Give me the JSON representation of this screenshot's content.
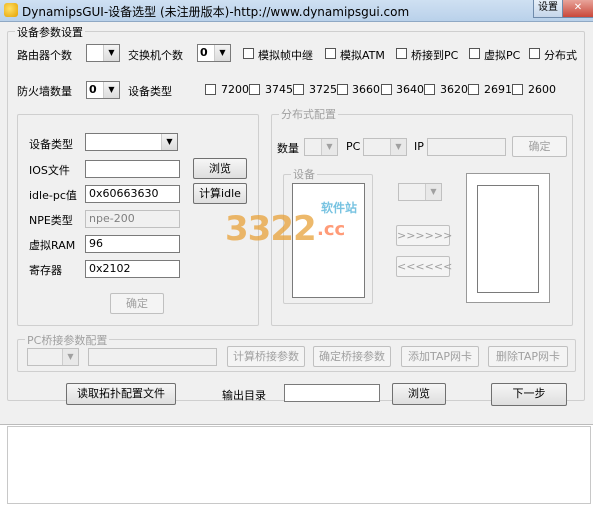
{
  "window": {
    "title": "DynamipsGUI-设备选型 (未注册版本)-http://www.dynamipsgui.com",
    "settings_label": "设置",
    "close_label": "✕"
  },
  "main_group": {
    "title": "设备参数设置",
    "router_count_label": "路由器个数",
    "router_count_value": "",
    "switch_count_label": "交换机个数",
    "switch_count_value": "0",
    "checkboxes_top": [
      "模拟帧中继",
      "模拟ATM",
      "桥接到PC",
      "虚拟PC",
      "分布式"
    ],
    "firewall_label": "防火墙数量",
    "firewall_value": "0",
    "device_type_label": "设备类型",
    "models": [
      "7200",
      "3745",
      "3725",
      "3660",
      "3640",
      "3620",
      "2691",
      "2600"
    ]
  },
  "device_panel": {
    "device_type_label": "设备类型",
    "device_type_value": "",
    "ios_label": "IOS文件",
    "ios_value": "",
    "browse_label": "浏览",
    "idlepc_label": "idle-pc值",
    "idlepc_value": "0x60663630",
    "calc_idle_label": "计算idle",
    "npe_label": "NPE类型",
    "npe_value": "npe-200",
    "ram_label": "虚拟RAM",
    "ram_value": "96",
    "reg_label": "寄存器",
    "reg_value": "0x2102",
    "ok_label": "确定"
  },
  "distributed": {
    "title": "分布式配置",
    "count_label": "数量",
    "pc_label": "PC",
    "ip_label": "IP",
    "ok_label": "确定",
    "devices_title": "设备",
    "forward_label": ">>>>>>",
    "back_label": "<<<<<<"
  },
  "bridge": {
    "title": "PC桥接参数配置",
    "calc_label": "计算桥接参数",
    "confirm_label": "确定桥接参数",
    "add_tap_label": "添加TAP网卡",
    "del_tap_label": "删除TAP网卡"
  },
  "footer": {
    "read_topo_label": "读取拓扑配置文件",
    "output_dir_label": "输出目录",
    "output_dir_value": "",
    "browse_label": "浏览",
    "next_label": "下一步"
  },
  "watermark": {
    "big_text": "3322",
    "suffix": ".cc",
    "caption": "软件站"
  }
}
